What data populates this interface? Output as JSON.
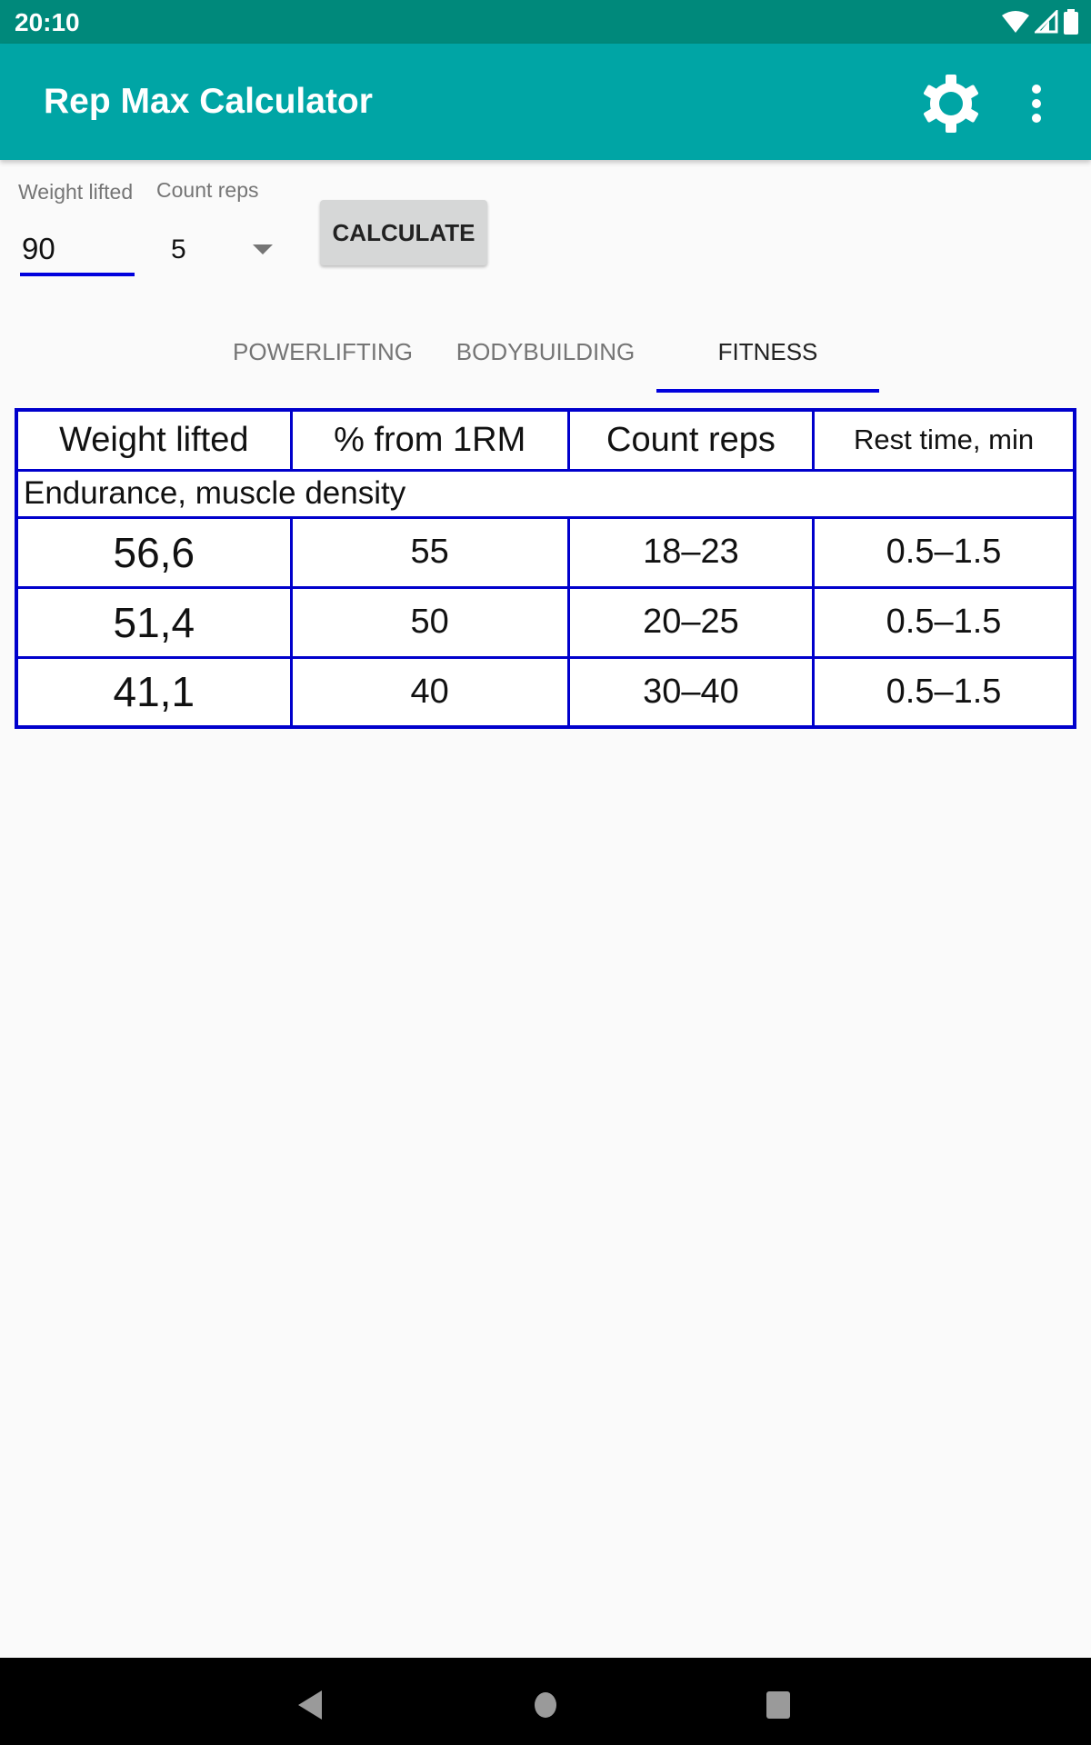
{
  "status_bar": {
    "time": "20:10",
    "icons": [
      "wifi-icon",
      "signal-icon",
      "battery-icon"
    ]
  },
  "app_bar": {
    "title": "Rep Max Calculator",
    "settings_icon": "gear-icon",
    "menu_icon": "more-vert-icon"
  },
  "form": {
    "weight_label": "Weight lifted",
    "weight_value": "90",
    "reps_label": "Count reps",
    "reps_value": "5",
    "calculate_label": "CALCULATE"
  },
  "tabs": [
    {
      "label": "POWERLIFTING",
      "active": false
    },
    {
      "label": "BODYBUILDING",
      "active": false
    },
    {
      "label": "FITNESS",
      "active": true
    }
  ],
  "table": {
    "headers": [
      "Weight lifted",
      "% from 1RM",
      "Count reps",
      "Rest time, min"
    ],
    "section": "Endurance, muscle density",
    "rows": [
      [
        "56,6",
        "55",
        "18–23",
        "0.5–1.5"
      ],
      [
        "51,4",
        "50",
        "20–25",
        "0.5–1.5"
      ],
      [
        "41,1",
        "40",
        "30–40",
        "0.5–1.5"
      ]
    ]
  },
  "nav_bar": {
    "back": "back-icon",
    "home": "home-icon",
    "recents": "recents-icon"
  },
  "colors": {
    "status_bar": "#00897b",
    "app_bar": "#00a5a5",
    "accent": "#0000dd",
    "table_border": "#0000cc"
  }
}
